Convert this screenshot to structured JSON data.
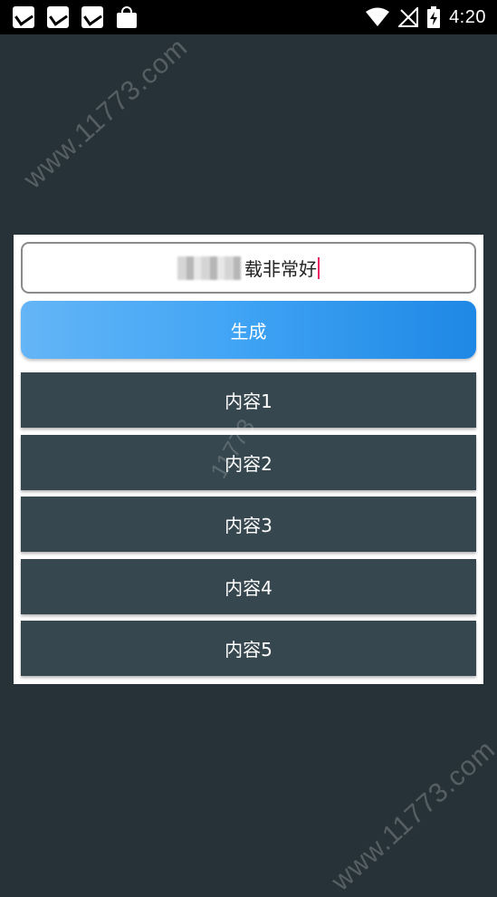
{
  "status_bar": {
    "time": "4:20",
    "notification_icons": [
      "app-notification-icon",
      "app-notification-icon",
      "app-notification-icon",
      "shopping-bag-icon"
    ],
    "status_icons": [
      "wifi-icon",
      "no-signal-icon",
      "battery-charging-icon"
    ]
  },
  "watermark": {
    "text": "www.11773.com",
    "mid_text": "11773"
  },
  "input": {
    "value_visible": "载非常好"
  },
  "generate_button": {
    "label": "生成",
    "gradient": [
      "#64b5f6",
      "#1e88e5"
    ]
  },
  "results": [
    {
      "label": "内容1"
    },
    {
      "label": "内容2"
    },
    {
      "label": "内容3"
    },
    {
      "label": "内容4"
    },
    {
      "label": "内容5"
    }
  ],
  "colors": {
    "background": "#263238",
    "item_background": "#37474f",
    "cursor": "#e91e63"
  }
}
